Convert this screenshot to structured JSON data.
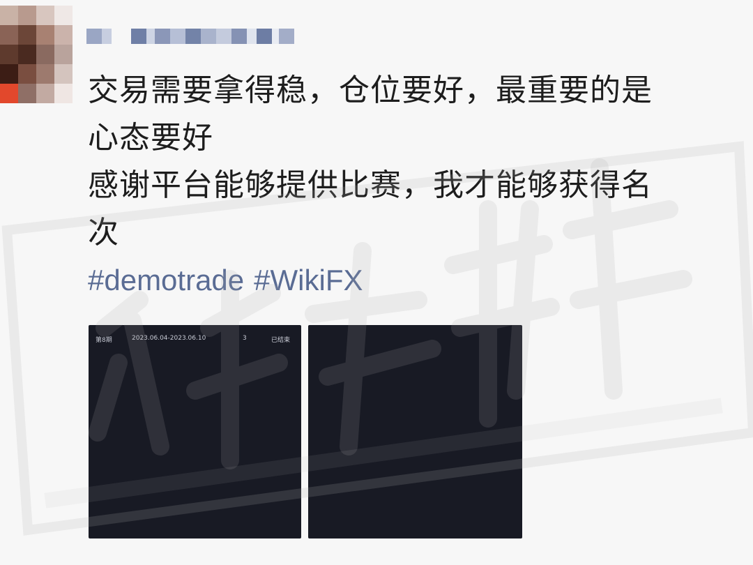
{
  "post": {
    "lines": [
      "交易需要拿得稳，仓位要好，最重要的是",
      "心态要好",
      "感谢平台能够提供比赛，我才能够获得名",
      "次"
    ],
    "hashtags": [
      "#demotrade",
      "#WikiFX"
    ]
  },
  "thumbnails": [
    {
      "period": "第8期",
      "date_range": "2023.06.04-2023.06.10",
      "rank": "3",
      "status": "已结束"
    },
    {}
  ],
  "watermark_text": "外汇天眼",
  "colors": {
    "background": "#f7f7f7",
    "text": "#1d1d1d",
    "hashtag": "#5a6c94",
    "thumbnail_bg": "#181a24"
  }
}
